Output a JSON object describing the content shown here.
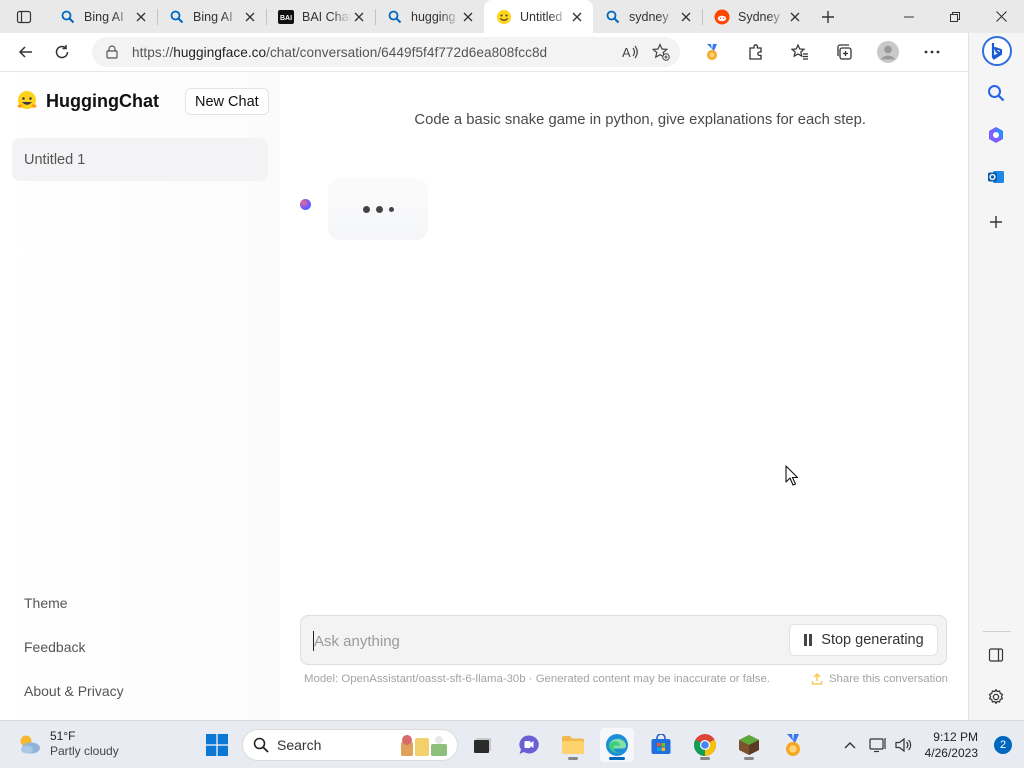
{
  "browser": {
    "tabs": [
      {
        "title": "Bing AI",
        "icon": "search-icon"
      },
      {
        "title": "Bing AI",
        "icon": "search-icon"
      },
      {
        "title": "BAI Chat",
        "icon": "bai-logo-icon"
      },
      {
        "title": "hugging",
        "icon": "search-icon"
      },
      {
        "title": "Untitled",
        "icon": "hugging-face-icon",
        "active": true
      },
      {
        "title": "sydney",
        "icon": "search-icon"
      },
      {
        "title": "Sydney",
        "icon": "reddit-icon"
      }
    ],
    "url_scheme": "https://",
    "url_host": "huggingface.co",
    "url_path": "/chat/conversation/6449f5f4f772d6ea808fcc8d"
  },
  "sidebar": {
    "brand": "HuggingChat",
    "new_chat_label": "New Chat",
    "conversations": [
      "Untitled 1"
    ],
    "links": [
      "Theme",
      "Feedback",
      "About & Privacy"
    ]
  },
  "chat": {
    "user_message": "Code a basic snake game in python, give explanations for each step.",
    "input_placeholder": "Ask anything",
    "stop_label": "Stop generating",
    "footer_model": "Model: OpenAssistant/oasst-sft-6-llama-30b · Generated content may be inaccurate or false.",
    "share_label": "Share this conversation"
  },
  "taskbar": {
    "temperature": "51°F",
    "weather": "Partly cloudy",
    "search_label": "Search",
    "time": "9:12 PM",
    "date": "4/26/2023",
    "notifications": "2"
  },
  "colors": {
    "accent": "#0067c0",
    "input_bg": "#f3f3f3",
    "bubble_bg": "#f5f6f8"
  }
}
